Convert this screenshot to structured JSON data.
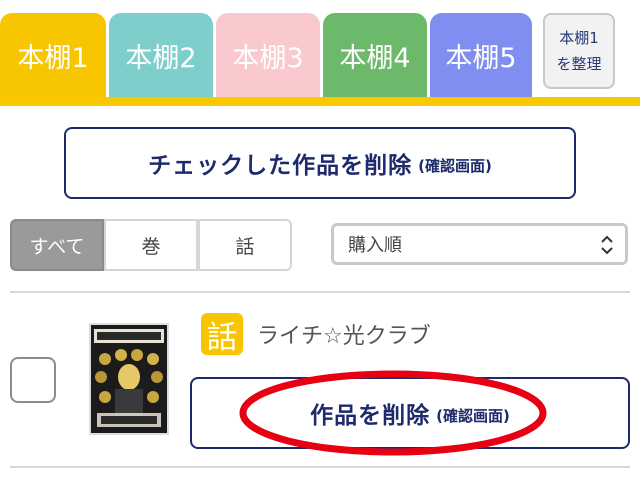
{
  "tabs": [
    {
      "label": "本棚1",
      "color": "#f7c600"
    },
    {
      "label": "本棚2",
      "color": "#7ecfcc"
    },
    {
      "label": "本棚3",
      "color": "#f9c9ce"
    },
    {
      "label": "本棚4",
      "color": "#6db96c"
    },
    {
      "label": "本棚5",
      "color": "#7f8ef0"
    }
  ],
  "organize": {
    "line1": "本棚1",
    "line2": "を整理"
  },
  "bulk_delete": {
    "main": "チェックした作品を削除",
    "sub": "(確認画面)"
  },
  "filters": {
    "all": "すべて",
    "volume": "巻",
    "episode": "話"
  },
  "sort": {
    "selected": "購入順"
  },
  "item": {
    "badge": "話",
    "title": "ライチ☆光クラブ",
    "delete_main": "作品を削除",
    "delete_sub": "(確認画面)"
  },
  "colors": {
    "accent": "#f8c800",
    "navy": "#1e2a6b",
    "annotation_red": "#e60012"
  }
}
